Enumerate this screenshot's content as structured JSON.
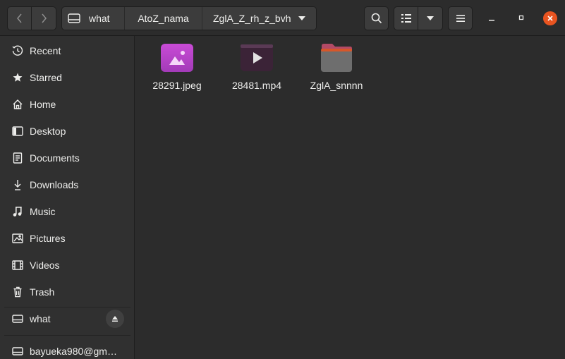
{
  "header": {
    "back_icon": "chevron-left-icon",
    "forward_icon": "chevron-right-icon",
    "breadcrumbs": [
      "what",
      "AtoZ_nama",
      "ZglA_Z_rh_z_bvh"
    ],
    "search_icon": "search-icon",
    "view_icon": "list-view-icon",
    "view_dropdown_icon": "chevron-down-icon",
    "menu_icon": "hamburger-menu-icon"
  },
  "sidebar": {
    "items": [
      {
        "label": "Recent",
        "icon": "clock-icon"
      },
      {
        "label": "Starred",
        "icon": "star-icon"
      },
      {
        "label": "Home",
        "icon": "home-icon"
      },
      {
        "label": "Desktop",
        "icon": "desktop-icon"
      },
      {
        "label": "Documents",
        "icon": "document-icon"
      },
      {
        "label": "Downloads",
        "icon": "download-icon"
      },
      {
        "label": "Music",
        "icon": "music-icon"
      },
      {
        "label": "Pictures",
        "icon": "picture-icon"
      },
      {
        "label": "Videos",
        "icon": "video-icon"
      },
      {
        "label": "Trash",
        "icon": "trash-icon"
      },
      {
        "label": "what",
        "icon": "drive-icon"
      },
      {
        "label": "bayueka980@gm…",
        "icon": "network-drive-icon"
      }
    ]
  },
  "files": [
    {
      "name": "28291.jpeg",
      "type": "image"
    },
    {
      "name": "28481.mp4",
      "type": "video"
    },
    {
      "name": "ZglA_snnnn",
      "type": "folder"
    }
  ],
  "colors": {
    "accent": "#e95420",
    "background": "#2c2c2c",
    "sidebar": "#303030"
  }
}
